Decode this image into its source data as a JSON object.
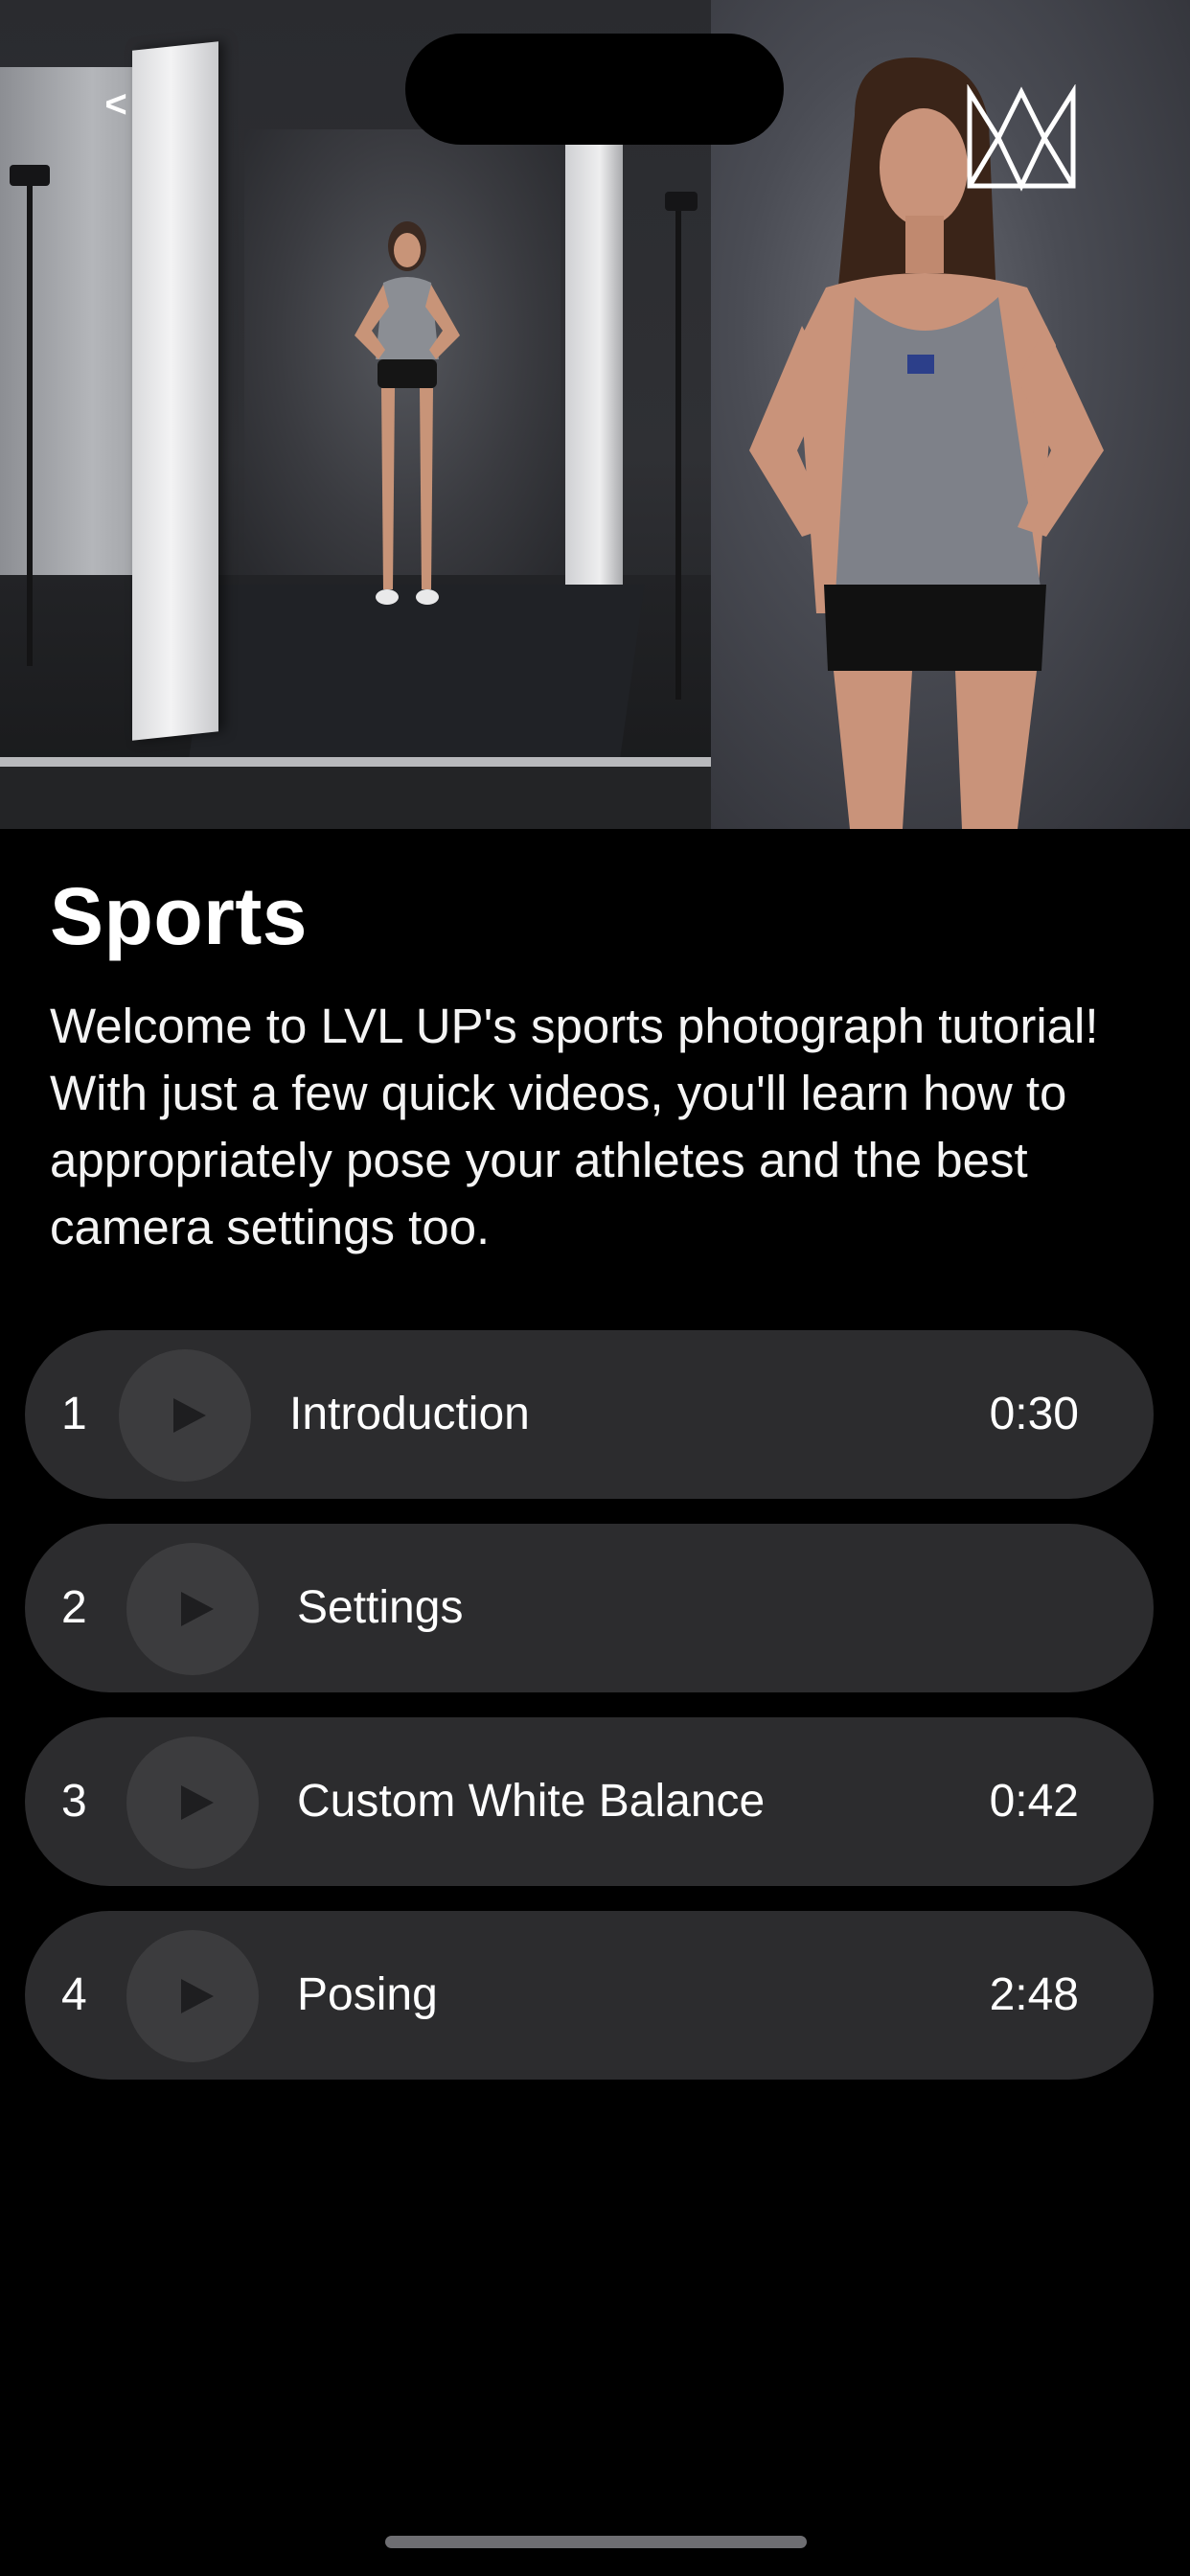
{
  "nav": {
    "back_label": "<",
    "logo_icon": "lvl-up-crown-icon"
  },
  "hero": {
    "photo_description_icon": "studio-photo"
  },
  "page": {
    "title": "Sports",
    "description": "Welcome to LVL UP's sports photograph tutorial! With just a few quick videos, you'll learn how to appropriately pose your athletes and the best camera settings too."
  },
  "videos": [
    {
      "number": "1",
      "title": "Introduction",
      "duration": "0:30"
    },
    {
      "number": "2",
      "title": "Settings",
      "duration": ""
    },
    {
      "number": "3",
      "title": "Custom White Balance",
      "duration": "0:42"
    },
    {
      "number": "4",
      "title": "Posing",
      "duration": "2:48"
    }
  ],
  "colors": {
    "background": "#000000",
    "row_background": "#2c2c2e",
    "play_circle": "#3c3c3e",
    "play_triangle": "#1e1e20",
    "text": "#ffffff"
  }
}
